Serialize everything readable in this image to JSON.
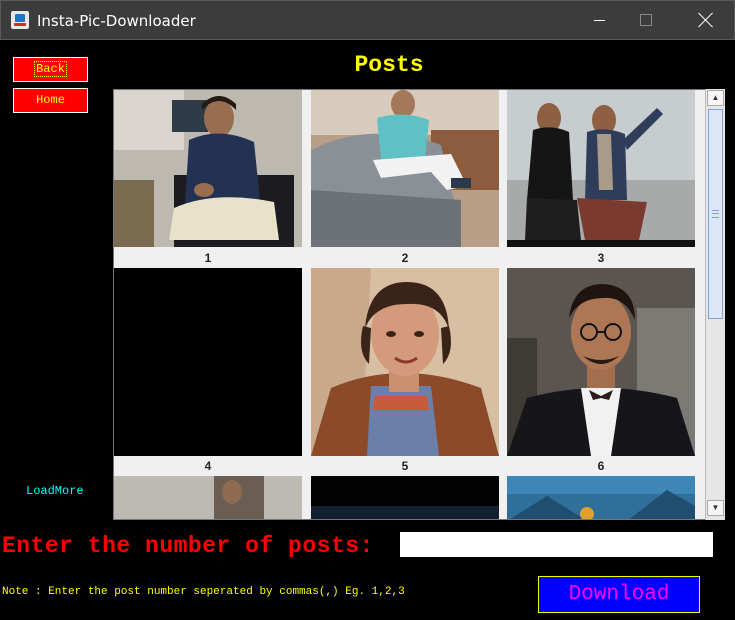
{
  "window": {
    "title": "Insta-Pic-Downloader"
  },
  "nav": {
    "back_label": "Back",
    "home_label": "Home"
  },
  "page": {
    "heading": "Posts"
  },
  "posts": [
    {
      "number": "1"
    },
    {
      "number": "2"
    },
    {
      "number": "3"
    },
    {
      "number": "4"
    },
    {
      "number": "5"
    },
    {
      "number": "6"
    }
  ],
  "load_more_label": "LoadMore",
  "form": {
    "prompt": "Enter the number of posts:",
    "input_value": "",
    "note": "Note : Enter the post number seperated by commas(,) Eg. 1,2,3",
    "download_label": "Download"
  },
  "icons": {
    "app": "java-cup-icon",
    "minimize": "minimize-icon",
    "maximize": "maximize-icon",
    "close": "close-icon"
  },
  "colors": {
    "background": "#000000",
    "button_red": "#ff0000",
    "heading_yellow": "#ffff00",
    "link_cyan": "#00ffff",
    "download_blue": "#0000ff",
    "download_text": "#ff00ff"
  }
}
